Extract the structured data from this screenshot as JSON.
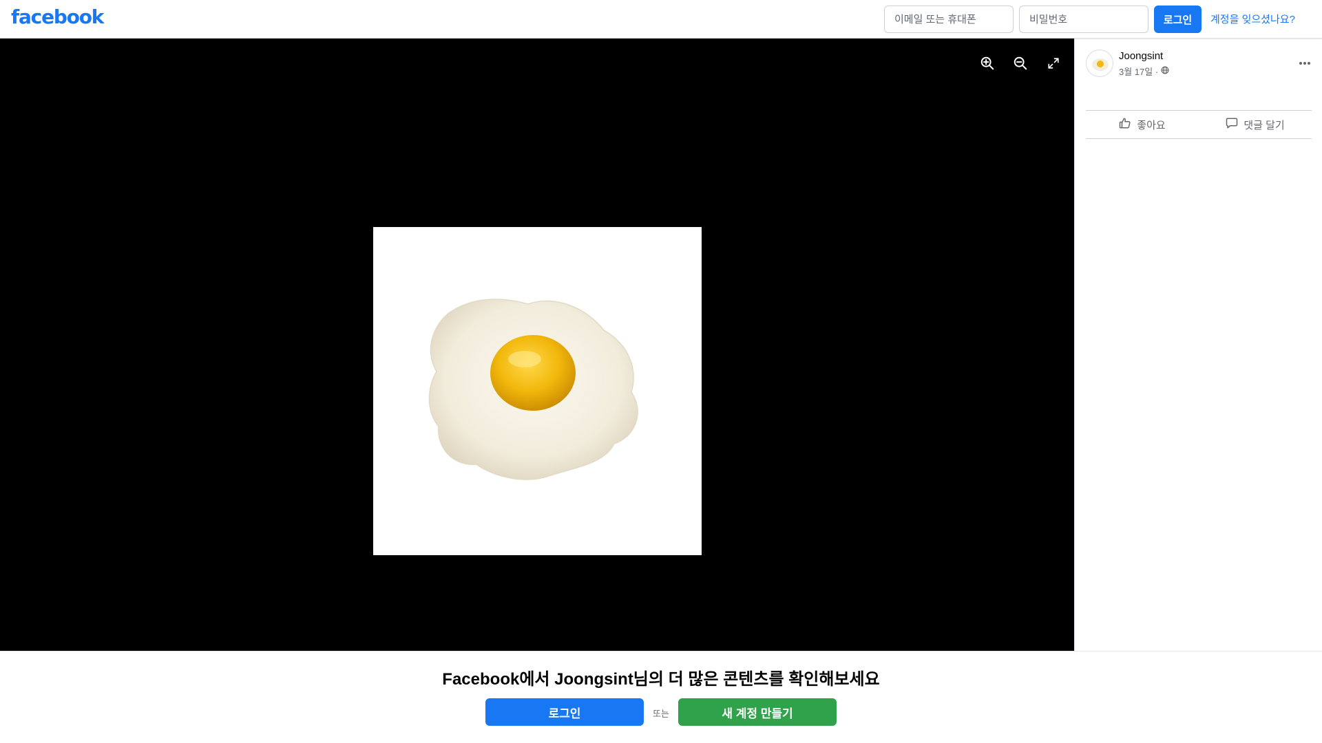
{
  "header": {
    "logo": "facebook",
    "email_placeholder": "이메일 또는 휴대폰",
    "password_placeholder": "비밀번호",
    "login_label": "로그인",
    "forgot_label": "계정을 잊으셨나요?",
    "brand_color": "#1877f2"
  },
  "viewer": {
    "photo_subject": "fried-egg",
    "tools": [
      "zoom-in-icon",
      "zoom-out-icon",
      "fullscreen-icon"
    ],
    "background_color": "#000000"
  },
  "post": {
    "author": "Joongsint",
    "date": "3월 17일 ·",
    "audience_icon": "globe-icon",
    "more_icon": "more-icon",
    "actions": {
      "like_label": "좋아요",
      "comment_label": "댓글 달기"
    }
  },
  "banner": {
    "title": "Facebook에서 Joongsint님의 더 많은 콘텐츠를 확인해보세요",
    "login_label": "로그인",
    "or_label": "또는",
    "signup_label": "새 계정 만들기",
    "signup_color": "#31a24c"
  }
}
